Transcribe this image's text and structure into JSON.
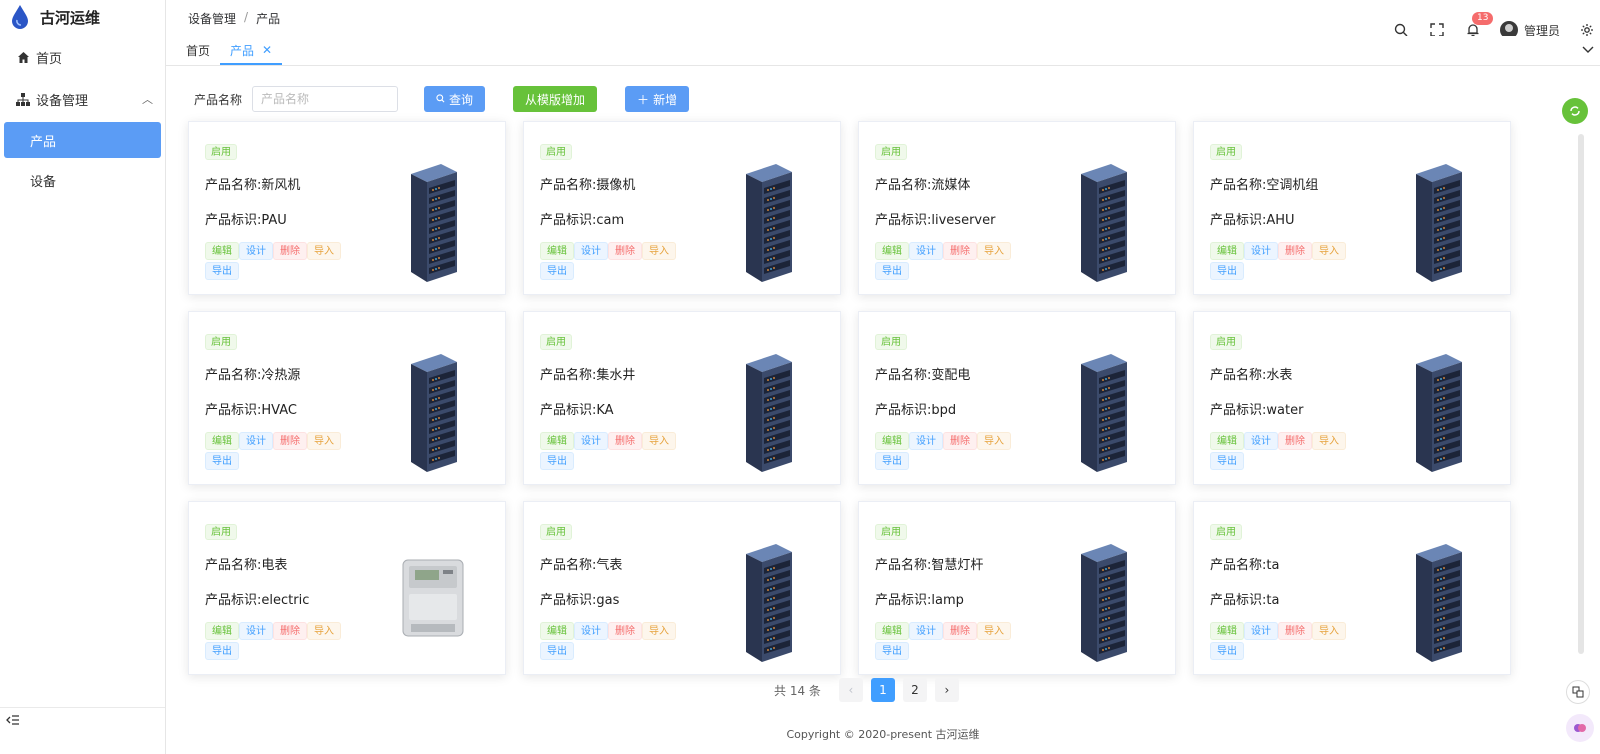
{
  "app": {
    "title": "古河运维"
  },
  "sidebar": {
    "home_label": "首页",
    "group_label": "设备管理",
    "items": [
      {
        "label": "产品",
        "active": true
      },
      {
        "label": "设备",
        "active": false
      }
    ]
  },
  "header": {
    "breadcrumb": [
      "设备管理",
      "/",
      "产品"
    ],
    "notifications_count": "13",
    "user_name": "管理员"
  },
  "tabs": [
    {
      "label": "首页"
    },
    {
      "label": "产品"
    }
  ],
  "search": {
    "label": "产品名称",
    "placeholder": "产品名称"
  },
  "toolbar": {
    "query_label": "查询",
    "from_template_label": "从模版增加",
    "add_label": "新增"
  },
  "card_labels": {
    "status": "启用",
    "edit": "编辑",
    "design": "设计",
    "delete": "删除",
    "import": "导入",
    "export": "导出"
  },
  "products": [
    {
      "name": "产品名称:新风机",
      "id": "产品标识:PAU",
      "image": "server-rack"
    },
    {
      "name": "产品名称:摄像机",
      "id": "产品标识:cam",
      "image": "server-rack"
    },
    {
      "name": "产品名称:流媒体",
      "id": "产品标识:liveserver",
      "image": "server-rack"
    },
    {
      "name": "产品名称:空调机组",
      "id": "产品标识:AHU",
      "image": "server-rack"
    },
    {
      "name": "产品名称:冷热源",
      "id": "产品标识:HVAC",
      "image": "server-rack"
    },
    {
      "name": "产品名称:集水井",
      "id": "产品标识:KA",
      "image": "server-rack"
    },
    {
      "name": "产品名称:变配电",
      "id": "产品标识:bpd",
      "image": "server-rack"
    },
    {
      "name": "产品名称:水表",
      "id": "产品标识:water",
      "image": "server-rack"
    },
    {
      "name": "产品名称:电表",
      "id": "产品标识:electric",
      "image": "electric-meter"
    },
    {
      "name": "产品名称:气表",
      "id": "产品标识:gas",
      "image": "server-rack"
    },
    {
      "name": "产品名称:智慧灯杆",
      "id": "产品标识:lamp",
      "image": "server-rack"
    },
    {
      "name": "产品名称:ta",
      "id": "产品标识:ta",
      "image": "server-rack"
    }
  ],
  "pagination": {
    "total_label": "共 14 条",
    "pages": [
      "1",
      "2"
    ],
    "current": "1"
  },
  "footer": {
    "copyright": "Copyright © 2020-present 古河运维"
  },
  "colors": {
    "primary": "#409eff",
    "success": "#67c23a",
    "danger": "#f56c6c",
    "warning": "#e6a23c"
  }
}
